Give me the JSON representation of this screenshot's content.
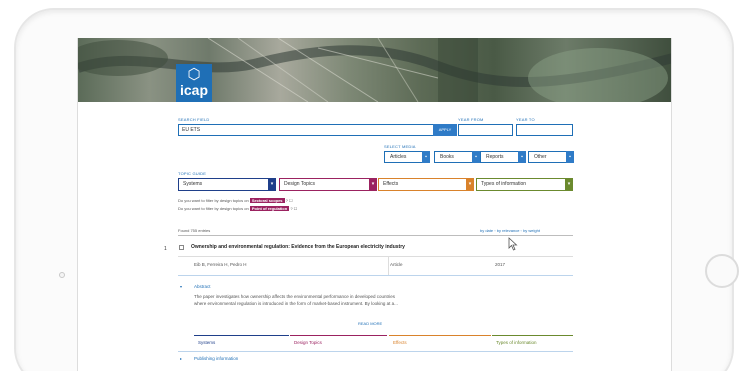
{
  "app": {
    "logo_text": "icap"
  },
  "search": {
    "field_label": "SEARCH FIELD",
    "value": "EU ETS",
    "apply_label": "APPLY",
    "year_from_label": "YEAR FROM",
    "year_to_label": "YEAR TO",
    "year_from": "",
    "year_to": ""
  },
  "media": {
    "label": "SELECT MEDIA",
    "items": [
      "Articles",
      "Books",
      "Reports",
      "Other"
    ]
  },
  "topics": {
    "label": "TOPIC GUIDE",
    "items": [
      {
        "label": "Systems",
        "color": "#1f3f8a"
      },
      {
        "label": "Design Topics",
        "color": "#9b2260"
      },
      {
        "label": "Effects",
        "color": "#d9822b"
      },
      {
        "label": "Types of information",
        "color": "#6b8a2e"
      }
    ]
  },
  "filters": {
    "sectoral_prefix": "Do you want to filter by design topics on",
    "sectoral_tag": "Sectoral scopes",
    "point_prefix": "Do you want to filter by design topics on",
    "point_tag": "Point of regulation",
    "tag_suffix": "? ☐"
  },
  "results": {
    "found": "Found 755 entries",
    "sort_text": "by date  ◦  by relevance  ◦  by weight",
    "items": [
      {
        "number": "1",
        "title": "Ownership and environmental regulation: Evidence from the European electricity industry",
        "authors": "Eib B, Ferreira H, Pedro H",
        "type": "Article",
        "year": "2017",
        "abstract_label": "Abstract",
        "abstract": "The paper investigates how ownership affects the environmental performance in developed countries where environmental regulation is introduced in the form of market-based instrument. By looking at a...",
        "read_more": "READ MORE",
        "categories": [
          "Systems",
          "Design Topics",
          "Effects",
          "Types of information"
        ],
        "publishing_info": "Publishing information"
      }
    ]
  }
}
